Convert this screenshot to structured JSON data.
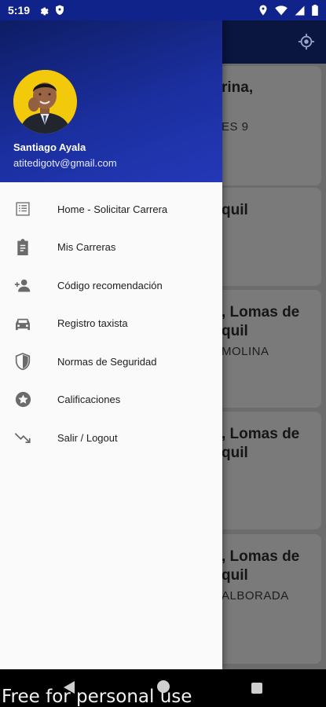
{
  "status_bar": {
    "time": "5:19"
  },
  "drawer": {
    "user_name": "Santiago Ayala",
    "user_email": "atitedigotv@gmail.com",
    "menu_items": [
      {
        "label": "Home - Solicitar Carrera",
        "icon": "list-icon"
      },
      {
        "label": "Mis Carreras",
        "icon": "clipboard-icon"
      },
      {
        "label": "Código recomendación",
        "icon": "add-person-icon"
      },
      {
        "label": "Registro taxista",
        "icon": "taxi-icon"
      },
      {
        "label": "Normas de Seguridad",
        "icon": "shield-icon"
      },
      {
        "label": "Calificaciones",
        "icon": "star-badge-icon"
      },
      {
        "label": "Salir / Logout",
        "icon": "logout-arrow-icon"
      }
    ]
  },
  "background_cards": [
    {
      "line1": "rina,",
      "line2": "",
      "line3": "ES 9"
    },
    {
      "line1": "quil",
      "line2": "",
      "line3": ""
    },
    {
      "line1": ", Lomas de",
      "line2": "quil",
      "line3": "MOLINA"
    },
    {
      "line1": ", Lomas de",
      "line2": "quil",
      "line3": ""
    },
    {
      "line1": ", Lomas de",
      "line2": "quil",
      "line3": "ALBORADA"
    }
  ],
  "watermark": "Free for personal use",
  "colors": {
    "drawer_header": "#1b2fa0",
    "avatar_bg": "#f3c90b",
    "status_bar": "#10238a"
  }
}
